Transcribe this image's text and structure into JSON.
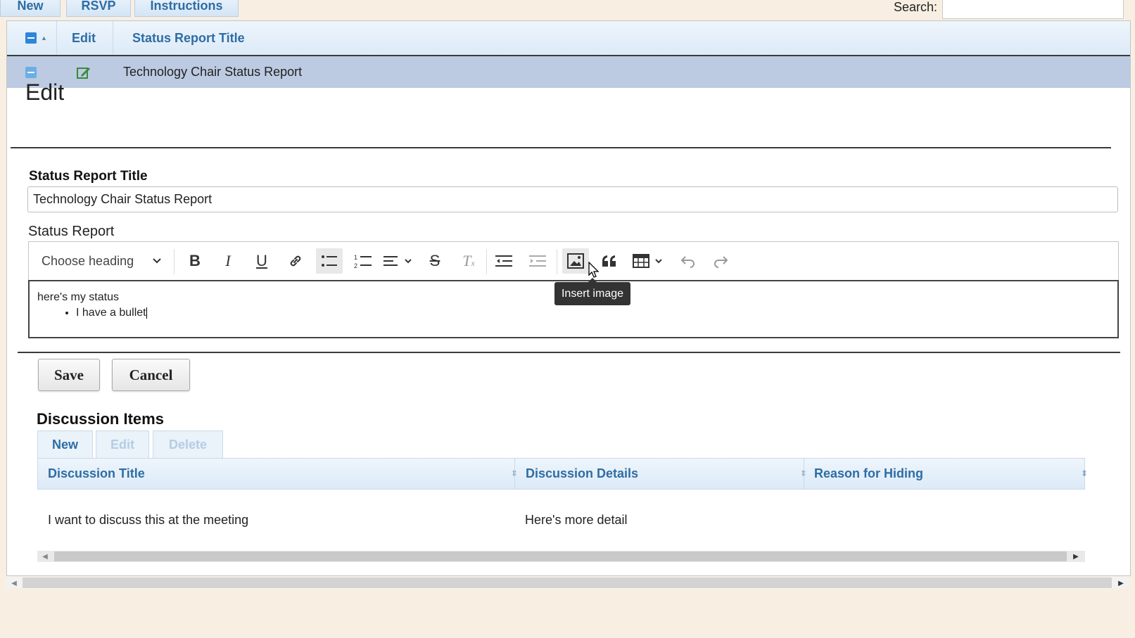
{
  "top_tabs": [
    {
      "label": "New"
    },
    {
      "label": "RSVP"
    },
    {
      "label": "Instructions"
    }
  ],
  "search": {
    "label": "Search:",
    "value": ""
  },
  "grid": {
    "columns": {
      "edit": "Edit",
      "title": "Status Report Title"
    },
    "row": {
      "title": "Technology Chair Status Report"
    }
  },
  "edit_form": {
    "heading": "Edit",
    "title_label": "Status Report Title",
    "title_value": "Technology Chair Status Report",
    "report_label": "Status Report",
    "toolbar": {
      "heading_select": "Choose heading",
      "tooltip": "Insert image"
    },
    "content": {
      "paragraph": "here's my status",
      "bullets": [
        "I have a bullet"
      ]
    },
    "save_label": "Save",
    "cancel_label": "Cancel"
  },
  "discussion": {
    "title": "Discussion Items",
    "buttons": {
      "new": "New",
      "edit": "Edit",
      "delete": "Delete"
    },
    "columns": [
      "Discussion Title",
      "Discussion Details",
      "Reason for Hiding"
    ],
    "rows": [
      [
        "I want to discuss this at the meeting",
        "Here's more detail",
        ""
      ]
    ]
  },
  "colors": {
    "link_blue": "#2e6da4",
    "selected_row": "#bccbe2",
    "page_bg": "#f8efe2"
  }
}
